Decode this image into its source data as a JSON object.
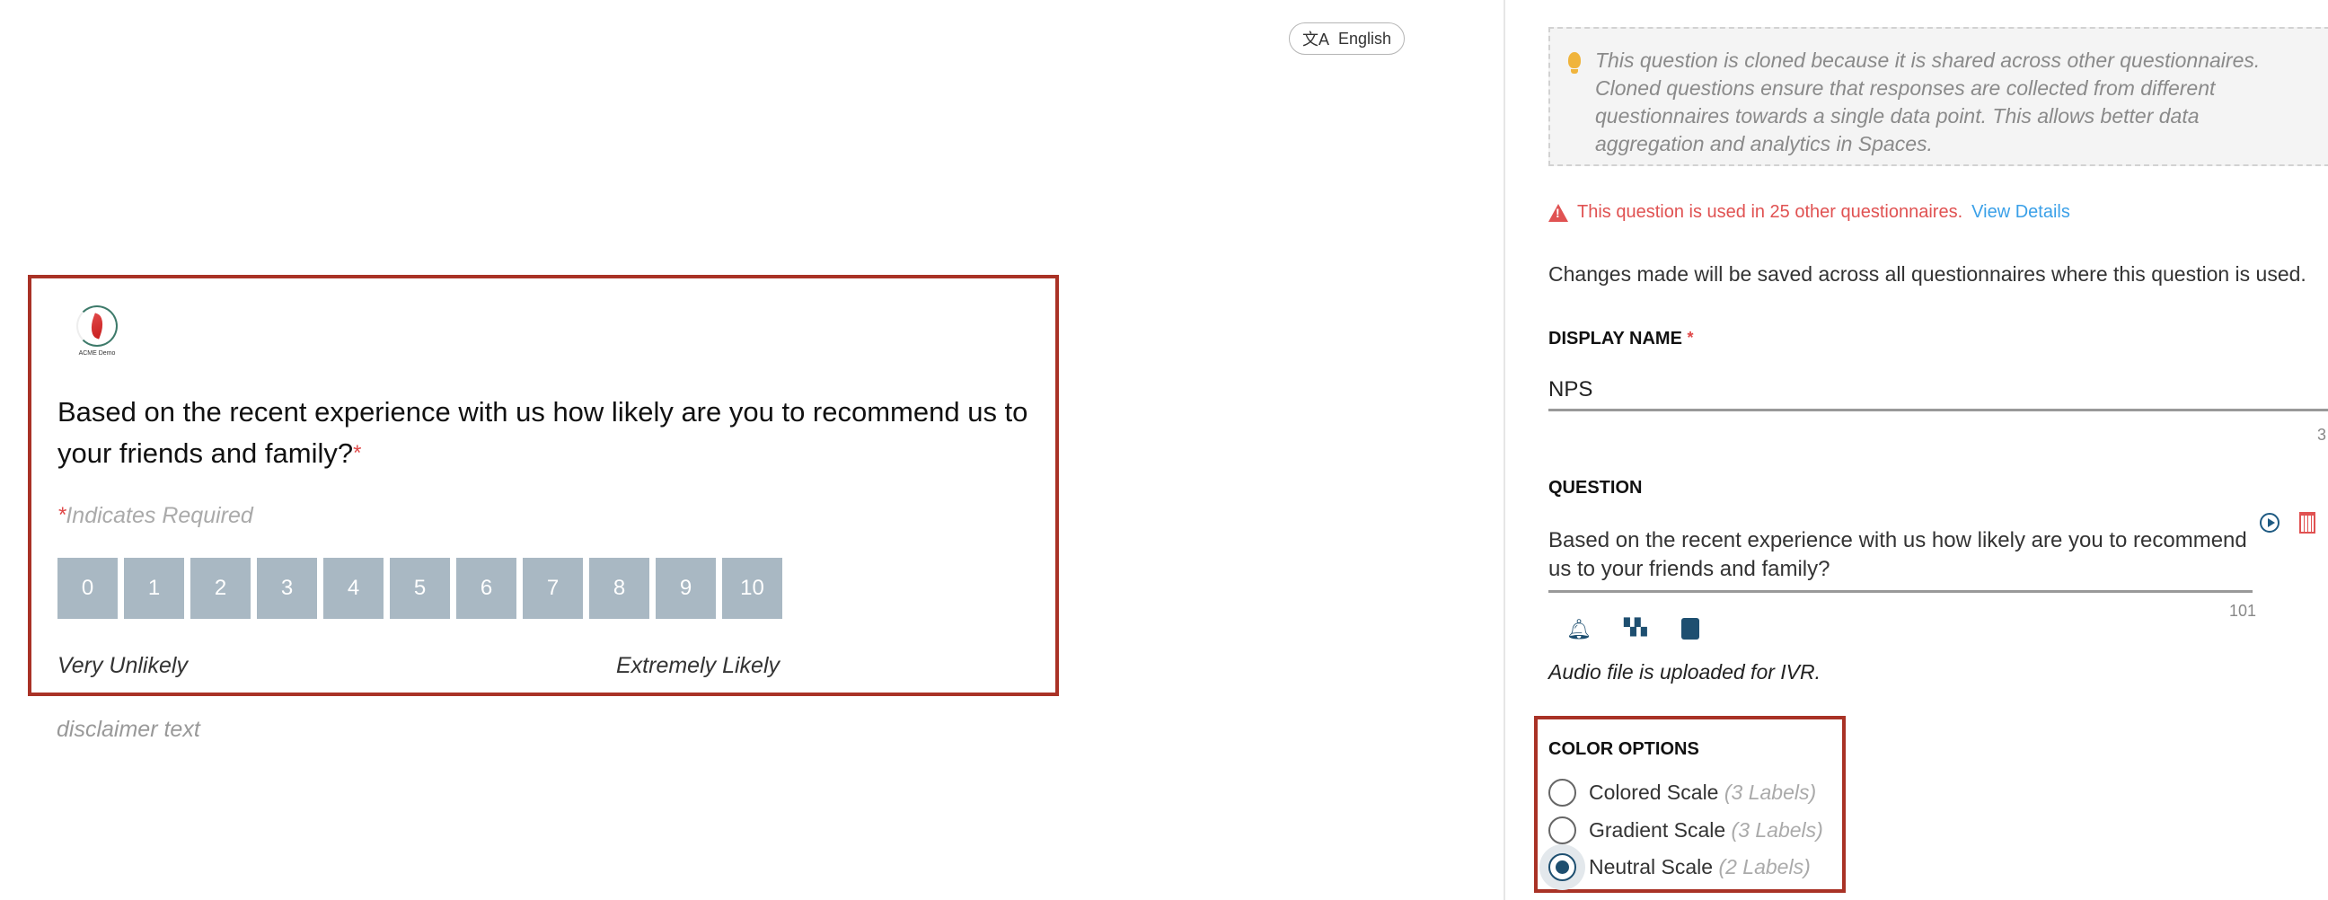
{
  "language_button": {
    "label": "English",
    "icon": "translate-icon"
  },
  "preview": {
    "logo_text": "ACME Demo",
    "question": "Based on the recent experience with us how likely are you to recommend us to your friends and family?",
    "required_mark": "*",
    "required_note": "Indicates Required",
    "scale": [
      "0",
      "1",
      "2",
      "3",
      "4",
      "5",
      "6",
      "7",
      "8",
      "9",
      "10"
    ],
    "low_label": "Very Unlikely",
    "high_label": "Extremely Likely",
    "disclaimer": "disclaimer text",
    "scale_color": "#a9b8c3",
    "highlight_color": "#a93226"
  },
  "editor": {
    "info": "This question is cloned because it is shared across other questionnaires. Cloned questions ensure that responses are collected from different questionnaires towards a single data point. This allows better data aggregation and analytics in Spaces.",
    "warning": "This question is used in 25 other questionnaires.",
    "view_details": "View Details",
    "changes_note": "Changes made will be saved across all questionnaires where this question is used.",
    "display_name_label": "DISPLAY NAME",
    "display_name_value": "NPS",
    "display_name_count": "3",
    "question_label": "QUESTION",
    "question_value": "Based on the recent experience with us how likely are you to recommend us to your friends and family?",
    "question_count": "101",
    "audio_note": "Audio file is uploaded for IVR.",
    "color_options_label": "COLOR OPTIONS",
    "color_options": [
      {
        "label": "Colored Scale",
        "hint": "(3 Labels)",
        "selected": false
      },
      {
        "label": "Gradient Scale",
        "hint": "(3 Labels)",
        "selected": false
      },
      {
        "label": "Neutral Scale",
        "hint": "(2 Labels)",
        "selected": true
      }
    ]
  }
}
